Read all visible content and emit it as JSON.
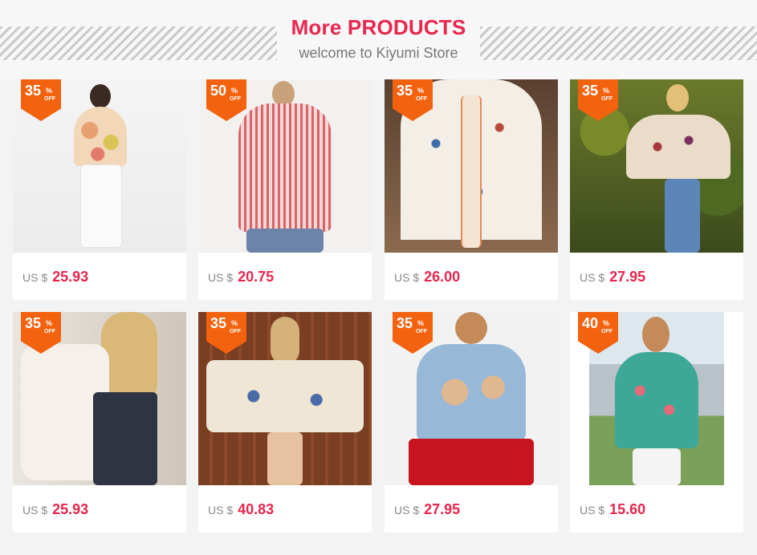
{
  "header": {
    "title": "More PRODUCTS",
    "subtitle": "welcome to Kiyumi Store"
  },
  "products": [
    {
      "discount": "35",
      "pct": "%",
      "off": "OFF",
      "currency": "US $",
      "price": "25.93"
    },
    {
      "discount": "50",
      "pct": "%",
      "off": "OFF",
      "currency": "US $",
      "price": "20.75"
    },
    {
      "discount": "35",
      "pct": "%",
      "off": "OFF",
      "currency": "US $",
      "price": "26.00"
    },
    {
      "discount": "35",
      "pct": "%",
      "off": "OFF",
      "currency": "US $",
      "price": "27.95"
    },
    {
      "discount": "35",
      "pct": "%",
      "off": "OFF",
      "currency": "US $",
      "price": "25.93"
    },
    {
      "discount": "35",
      "pct": "%",
      "off": "OFF",
      "currency": "US $",
      "price": "40.83"
    },
    {
      "discount": "35",
      "pct": "%",
      "off": "OFF",
      "currency": "US $",
      "price": "27.95"
    },
    {
      "discount": "40",
      "pct": "%",
      "off": "OFF",
      "currency": "US $",
      "price": "15.60"
    }
  ]
}
